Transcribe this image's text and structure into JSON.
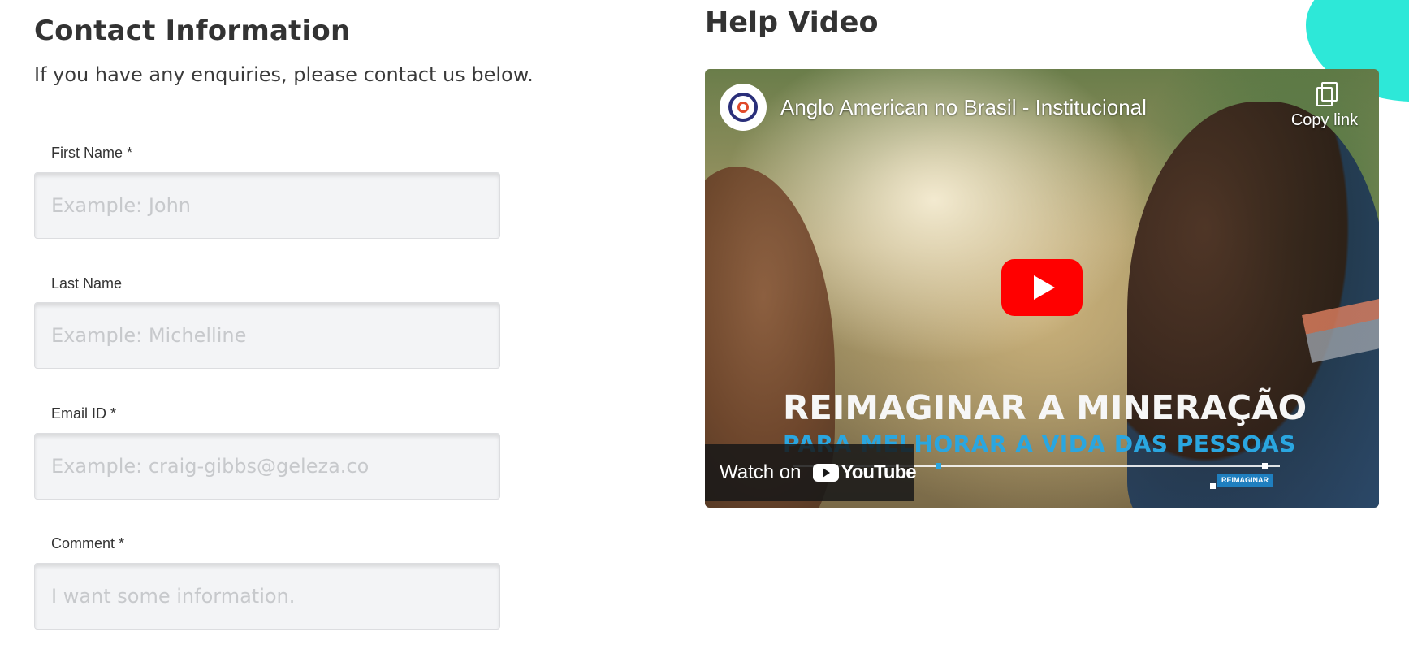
{
  "contact": {
    "title": "Contact Information",
    "subtitle": "If you have any enquiries, please contact us below.",
    "fields": [
      {
        "label": "First Name *",
        "placeholder": "Example: John"
      },
      {
        "label": "Last Name",
        "placeholder": "Example: Michelline"
      },
      {
        "label": "Email ID *",
        "placeholder": "Example: craig-gibbs@geleza.co"
      },
      {
        "label": "Comment *",
        "placeholder": "I want some information."
      }
    ]
  },
  "help": {
    "title": "Help Video",
    "video": {
      "title": "Anglo American no Brasil - Institucional",
      "copy_link_label": "Copy link",
      "overlay_line1": "REIMAGINAR A MINERAÇÃO",
      "overlay_line2": "PARA MELHORAR A VIDA DAS PESSOAS",
      "badge": "REIMAGINAR",
      "watch_on_label": "Watch on",
      "youtube_label": "YouTube"
    }
  },
  "colors": {
    "accent_blob": "#2de8d8",
    "play_button": "#ff0000",
    "overlay_blue": "#2aa6e0"
  },
  "icons": [
    "channel-logo-icon",
    "copy-icon",
    "play-icon",
    "youtube-logo-icon"
  ]
}
